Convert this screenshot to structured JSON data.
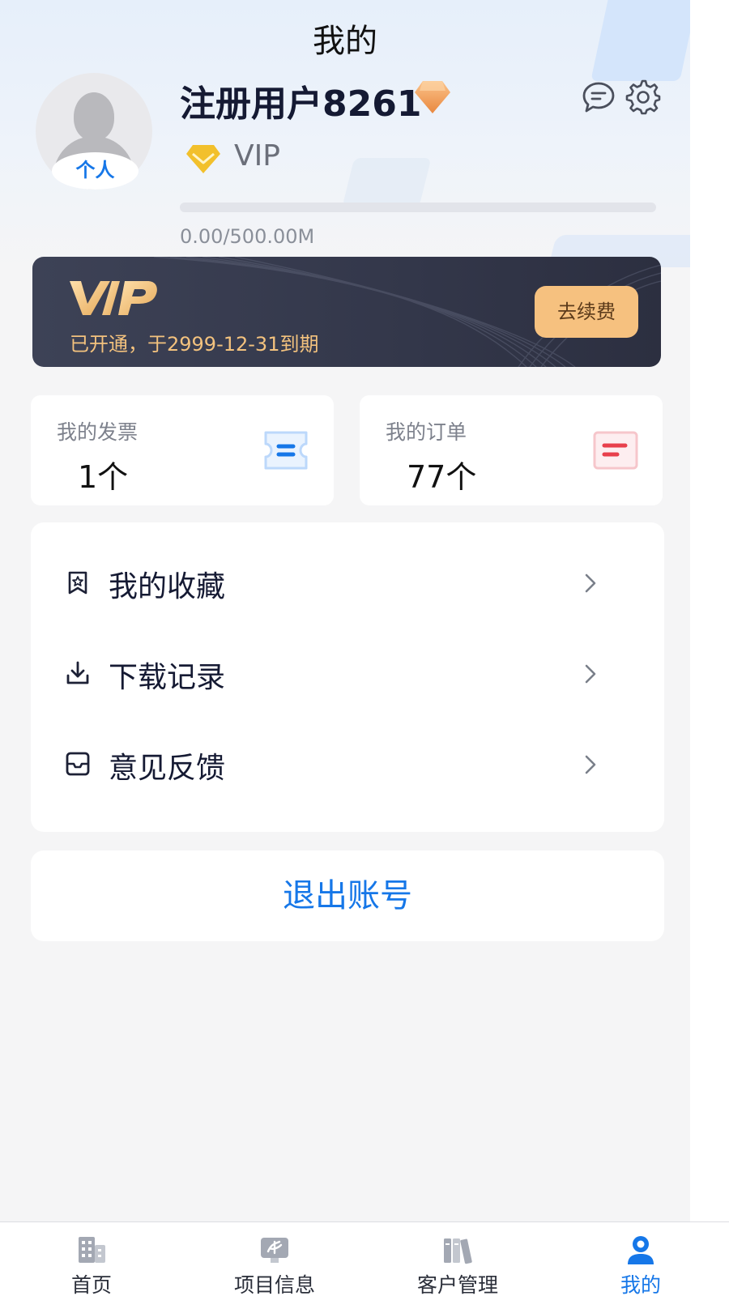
{
  "header": {
    "title": "我的"
  },
  "profile": {
    "avatar_tag": "个人",
    "username": "注册用户8261",
    "level": "VIP",
    "quota_text": "0.00/500.00M",
    "quota_used_fraction": 0.0
  },
  "vip_card": {
    "logo_text": "VIP",
    "expiry": "已开通，于2999-12-31到期",
    "renew_label": "去续费"
  },
  "stats": [
    {
      "label": "我的发票",
      "value": "1个",
      "icon": "ticket-icon"
    },
    {
      "label": "我的订单",
      "value": "77个",
      "icon": "order-list-icon"
    }
  ],
  "menu": [
    {
      "label": "我的收藏",
      "icon": "bookmark-star-icon"
    },
    {
      "label": "下载记录",
      "icon": "download-icon"
    },
    {
      "label": "意见反馈",
      "icon": "inbox-icon"
    }
  ],
  "logout_label": "退出账号",
  "tabs": [
    {
      "label": "首页",
      "icon": "building-icon",
      "active": false
    },
    {
      "label": "项目信息",
      "icon": "project-board-icon",
      "active": false
    },
    {
      "label": "客户管理",
      "icon": "books-icon",
      "active": false
    },
    {
      "label": "我的",
      "icon": "user-icon",
      "active": true
    }
  ],
  "colors": {
    "accent": "#1677e8",
    "vip_gold": "#f3c27e",
    "renew_button": "#f6c17f",
    "vip_card_bg": "#33374a",
    "invoice_icon": "#1677e8",
    "order_icon": "#e8404c"
  }
}
